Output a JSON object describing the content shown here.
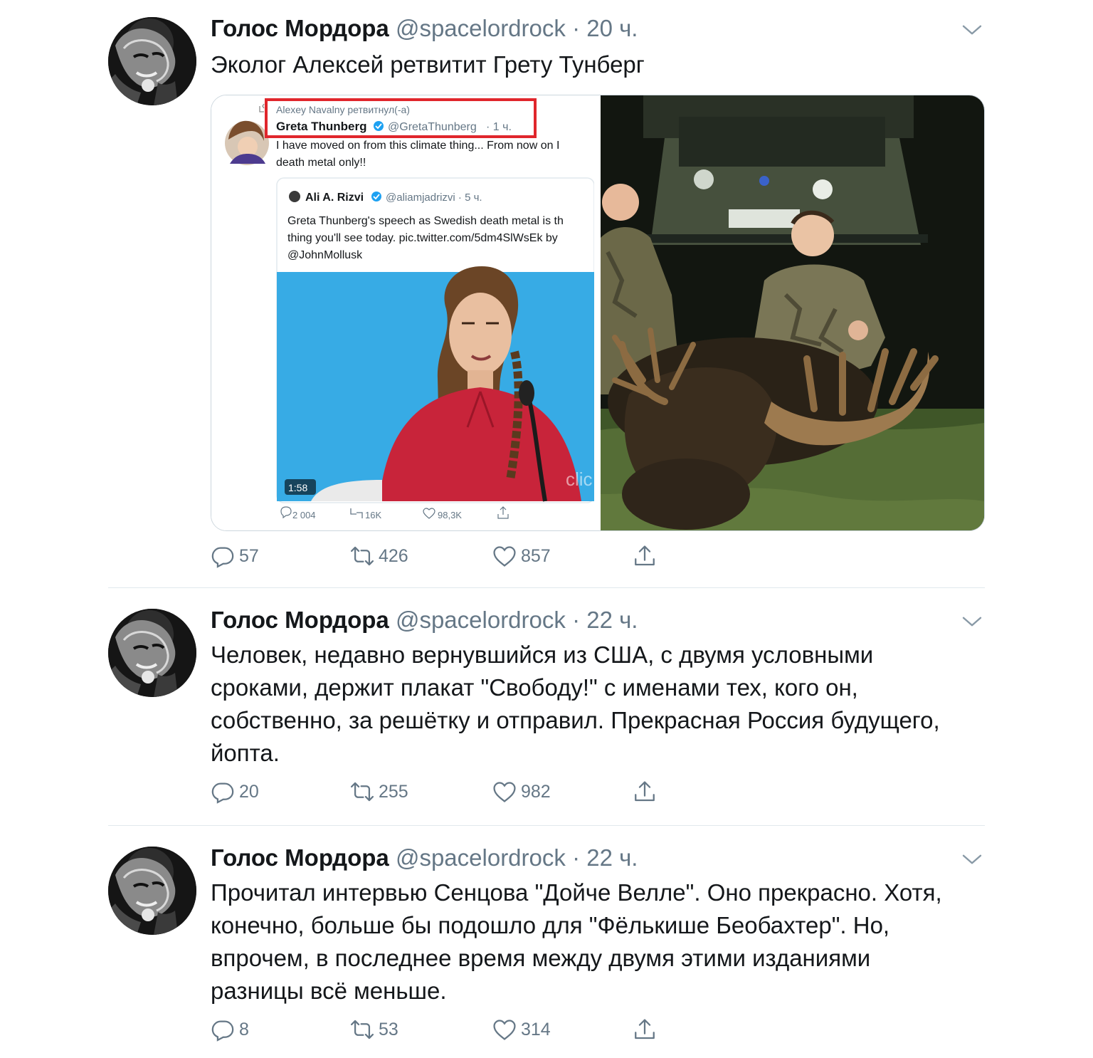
{
  "tweets": [
    {
      "name": "Голос Мордора",
      "handle": "@spacelordrock",
      "dot": "·",
      "time": "20 ч.",
      "text": "Эколог Алексей ретвитит Грету Тунберг",
      "replies": "57",
      "retweets": "426",
      "likes": "857",
      "embedded": {
        "retweeted_by": "Alexey Navalny ретвитнул(-а)",
        "author": "Greta Thunberg",
        "author_handle": "@GretaThunberg",
        "author_time": "· 1 ч.",
        "text_line1": "I have moved on from this climate thing... From now on I",
        "text_line2": "death metal only!!",
        "quote_author": "Ali A. Rizvi",
        "quote_handle": "@aliamjadrizvi · 5 ч.",
        "quote_line1": "Greta Thunberg's speech as Swedish  death metal is th",
        "quote_line2": "thing you'll see today. pic.twitter.com/5dm4SlWsEk by",
        "quote_line3": "@JohnMollusk",
        "video_duration": "1:58",
        "watermark": "clic",
        "stat_replies": "2 004",
        "stat_retweets": "16K",
        "stat_likes": "98,3K"
      }
    },
    {
      "name": "Голос Мордора",
      "handle": "@spacelordrock",
      "dot": "·",
      "time": "22 ч.",
      "text_lines": [
        "Человек, недавно вернувшийся из США, с двумя условными",
        "сроками, держит плакат \"Свободу!\" с именами тех, кого он,",
        "собственно, за решётку и отправил. Прекрасная Россия будущего,",
        "йопта."
      ],
      "replies": "20",
      "retweets": "255",
      "likes": "982"
    },
    {
      "name": "Голос Мордора",
      "handle": "@spacelordrock",
      "dot": "·",
      "time": "22 ч.",
      "text_lines": [
        "Прочитал интервью Сенцова \"Дойче Велле\". Оно прекрасно. Хотя,",
        "конечно, больше бы подошло для \"Фёлькише Беобахтер\". Но,",
        "впрочем, в последнее время между двумя этими изданиями",
        "разницы всё меньше."
      ],
      "replies": "8",
      "retweets": "53",
      "likes": "314"
    }
  ],
  "colors": {
    "text": "#14171a",
    "secondary": "#657786",
    "divider": "#e1e8ed",
    "verified": "#1da1f2",
    "highlight_box": "#e0262c"
  },
  "icons": [
    "chevron-down-icon",
    "reply-icon",
    "retweet-icon",
    "like-icon",
    "share-icon",
    "verified-icon"
  ]
}
